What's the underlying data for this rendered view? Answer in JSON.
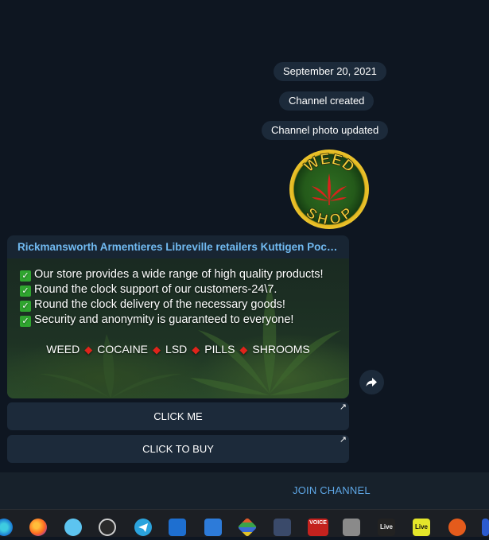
{
  "chat": {
    "date_pill": "September 20, 2021",
    "service_messages": [
      "Channel created",
      "Channel photo updated"
    ]
  },
  "avatar": {
    "text_top": "WEED",
    "text_bottom": "SHOP",
    "icon": "cannabis-leaf-icon"
  },
  "post": {
    "title": "Rickmansworth Armentieres Libreville retailers Kuttigen Pocki...",
    "lines": [
      "Our store provides a wide range of high quality products!",
      "Round the clock support of our customers-24\\7.",
      "Round the clock delivery of the necessary goods!",
      "Security and anonymity is guaranteed to everyone!"
    ],
    "products": [
      "WEED",
      "COCAINE",
      "LSD",
      "PILLS",
      "SHROOMS"
    ],
    "check_icon": "check-mark-icon",
    "separator_icon": "red-diamond-icon"
  },
  "buttons": [
    {
      "label": "CLICK ME",
      "icon": "external-link-arrow-icon"
    },
    {
      "label": "CLICK TO BUY",
      "icon": "external-link-arrow-icon"
    }
  ],
  "share_icon": "share-forward-icon",
  "bottom_bar": {
    "join_label": "JOIN CHANNEL"
  },
  "taskbar": {
    "items": [
      {
        "name": "edge-icon"
      },
      {
        "name": "firefox-icon"
      },
      {
        "name": "app-icon"
      },
      {
        "name": "obs-icon"
      },
      {
        "name": "telegram-icon"
      },
      {
        "name": "mail-icon"
      },
      {
        "name": "app-icon"
      },
      {
        "name": "app-icon"
      },
      {
        "name": "app-icon"
      },
      {
        "name": "voicemeeter-icon",
        "label": "VOICE"
      },
      {
        "name": "app-icon"
      },
      {
        "name": "live-icon",
        "label": "Live"
      },
      {
        "name": "live-icon",
        "label": "Live"
      },
      {
        "name": "ubuntu-icon"
      },
      {
        "name": "app-icon"
      }
    ]
  },
  "colors": {
    "background": "#0e1621",
    "bubble": "#182533",
    "pill": "#1c2a3a",
    "link_blue": "#71baf1",
    "join_blue": "#5ea7e6"
  }
}
